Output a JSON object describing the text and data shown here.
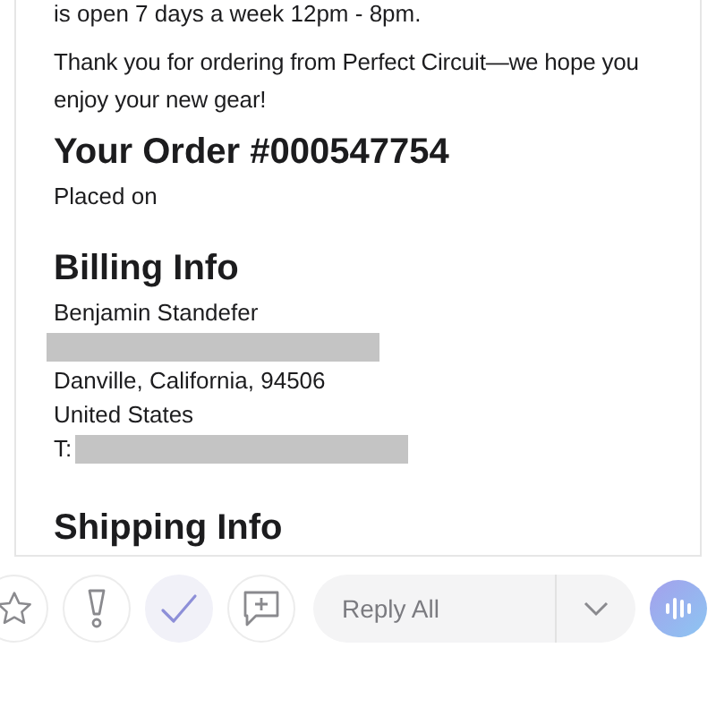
{
  "email": {
    "lines": [
      "is open 7 days a week 12pm - 8pm.",
      "Thank you for ordering from Perfect Circuit—we hope you enjoy your new gear!"
    ],
    "order_title": "Your Order #000547754",
    "placed_on": "Placed on",
    "billing": {
      "heading": "Billing Info",
      "name": "Benjamin Standefer",
      "city": "Danville, California, 94506",
      "country": "United States",
      "phone_label": "T:"
    },
    "shipping": {
      "heading": "Shipping Info"
    }
  },
  "toolbar": {
    "actions": [
      {
        "kind": "star",
        "selected": false
      },
      {
        "kind": "flag",
        "selected": false
      },
      {
        "kind": "check",
        "selected": true
      },
      {
        "kind": "comment",
        "selected": false
      }
    ],
    "reply": {
      "label": "Reply All"
    }
  }
}
